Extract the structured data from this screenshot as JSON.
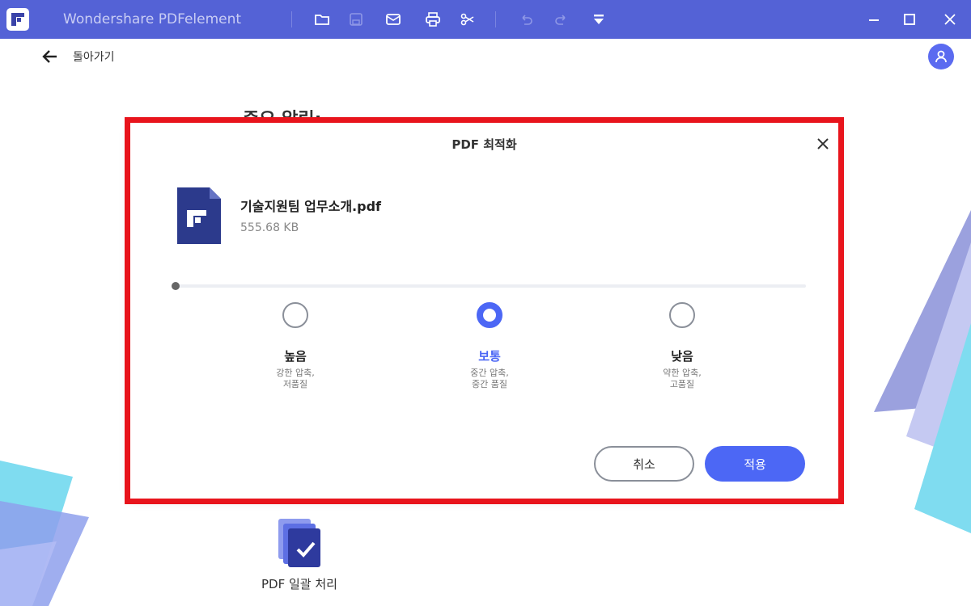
{
  "app": {
    "title": "Wondershare PDFelement"
  },
  "nav": {
    "back_label": "돌아가기"
  },
  "page": {
    "heading": "중요 알림:"
  },
  "dialog": {
    "title": "PDF 최적화",
    "file": {
      "name": "기술지원팀 업무소개.pdf",
      "size": "555.68 KB"
    },
    "options": [
      {
        "label": "높음",
        "desc1": "강한 압축,",
        "desc2": "저품질",
        "selected": false
      },
      {
        "label": "보통",
        "desc1": "중간 압축,",
        "desc2": "중간 품질",
        "selected": true
      },
      {
        "label": "낮음",
        "desc1": "약한 압축,",
        "desc2": "고품질",
        "selected": false
      }
    ],
    "cancel_label": "취소",
    "apply_label": "적용"
  },
  "batch": {
    "label": "PDF 일괄 처리"
  },
  "colors": {
    "titlebar": "#5462d6",
    "accent": "#4c67f5",
    "highlight": "#e8141c",
    "file_icon": "#2c3a8c"
  }
}
